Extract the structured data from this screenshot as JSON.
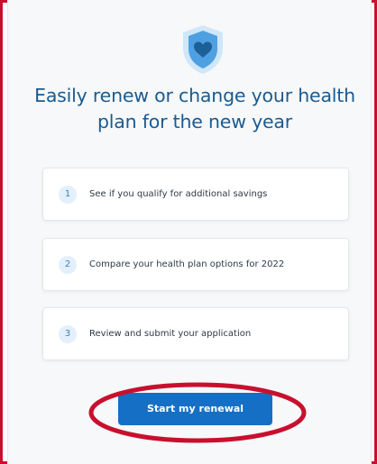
{
  "header": {
    "title": "Easily renew or change your health plan for the new year"
  },
  "icons": {
    "hero": "shield-heart-icon"
  },
  "steps": [
    {
      "number": "1",
      "label": "See if you qualify for additional savings"
    },
    {
      "number": "2",
      "label": "Compare your health plan options for 2022"
    },
    {
      "number": "3",
      "label": "Review and submit your application"
    }
  ],
  "actions": {
    "primary_label": "Start my renewal"
  },
  "colors": {
    "accent": "#1570c5",
    "heading": "#1a5b91",
    "annotation": "#c8102e",
    "step_badge_bg": "#e3f0fb"
  }
}
